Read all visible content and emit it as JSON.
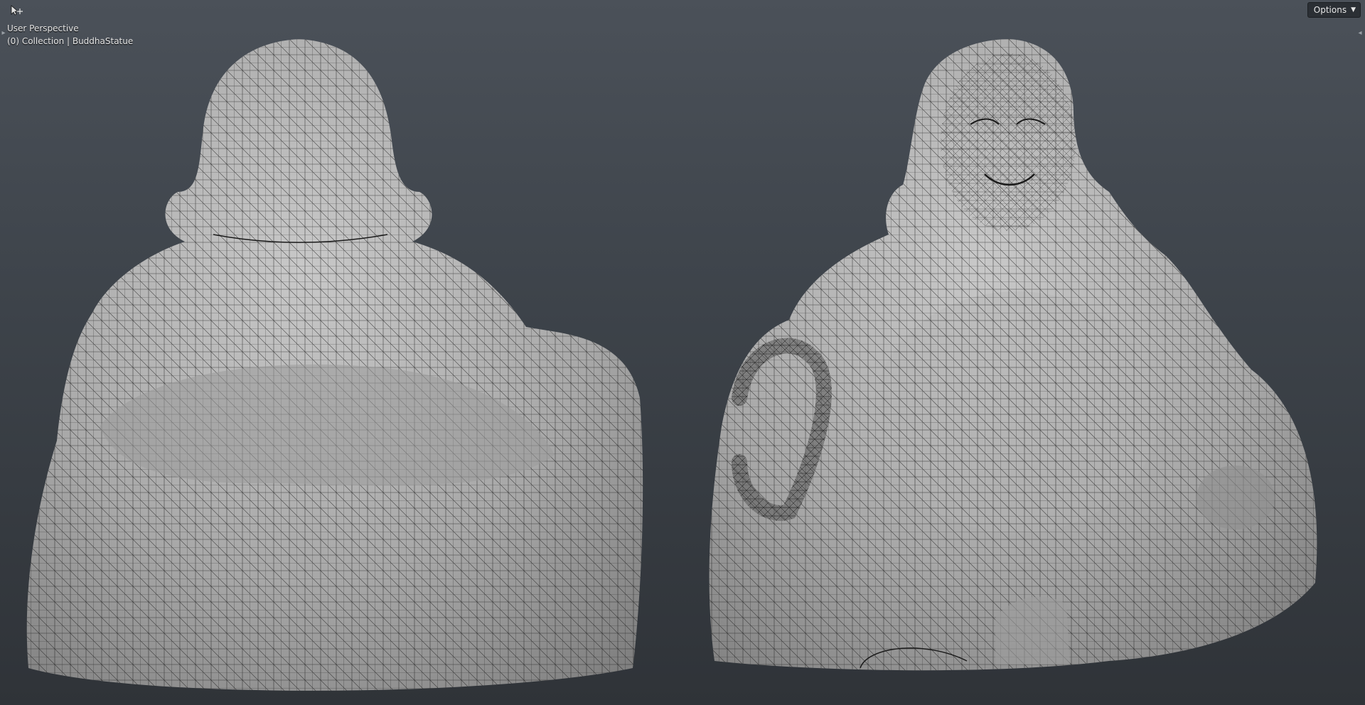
{
  "viewport": {
    "perspective_label": "User Perspective",
    "collection_label": "(0) Collection | BuddhaStatue"
  },
  "header": {
    "options_label": "Options",
    "options_icon": "chevron-down-icon"
  },
  "icons": {
    "tool": "select-cursor-icon",
    "toolbar_toggle": "chevron-right-icon",
    "sidebar_toggle": "chevron-left-icon"
  },
  "colors": {
    "background_top": "#4b5159",
    "background_bottom": "#2f3338",
    "mesh_fill": "#a9a9a9",
    "mesh_wire": "#1a1a1a"
  }
}
